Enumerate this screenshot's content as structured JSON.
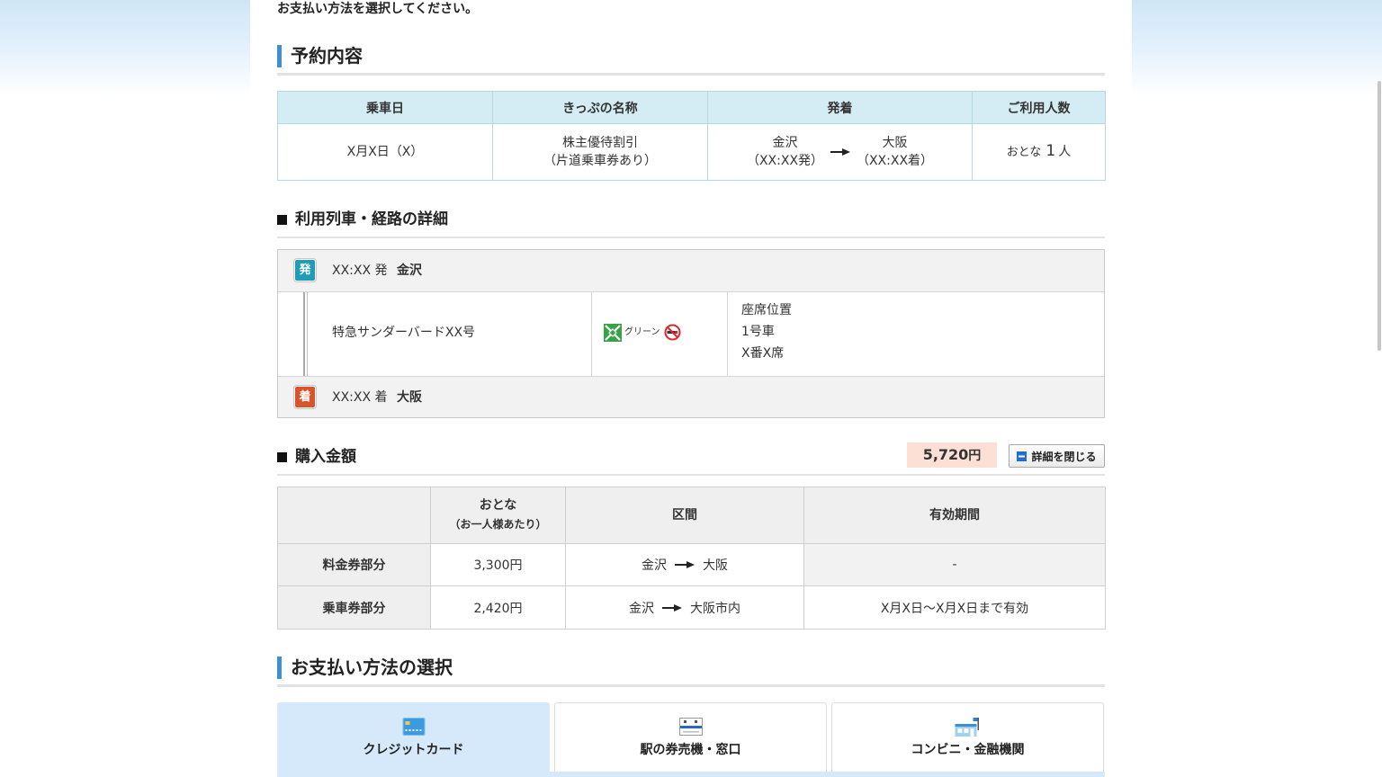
{
  "colors": {
    "heading_bar": "#3f8fd6",
    "reservation_header_bg": "#d4ecf3",
    "departure_badge": "#1f9db8",
    "arrival_badge": "#d9542a",
    "total_price_bg": "#fde0d5",
    "selected_tab_bg": "#d5e9fa",
    "green_car": "#35a447",
    "no_smoking": "#e0262d"
  },
  "instruction": "お支払い方法を選択してください。",
  "reservation": {
    "heading": "予約内容",
    "headers": {
      "date": "乗車日",
      "ticket_name": "きっぷの名称",
      "route": "発着",
      "passengers": "ご利用人数"
    },
    "date": "X月X日（X）",
    "ticket_name": [
      "株主優待割引",
      "（片道乗車券あり）"
    ],
    "departure": {
      "station": "金沢",
      "time": "（XX:XX発）"
    },
    "arrival": {
      "station": "大阪",
      "time": "（XX:XX着）"
    },
    "passengers": {
      "type": "おとな",
      "count": "1",
      "unit": "人"
    }
  },
  "route_detail": {
    "heading": "利用列車・経路の詳細",
    "departure": {
      "badge": "発",
      "time": "XX:XX 発",
      "station": "金沢"
    },
    "train": {
      "name": "特急サンダーバードXX号",
      "car_class": "グリーン",
      "car_class_icon": "green-car-icon",
      "smoking_icon": "no-smoking-icon",
      "seat_label": "座席位置",
      "car_number": "1号車",
      "seat_number": "X番X席"
    },
    "arrival": {
      "badge": "着",
      "time": "XX:XX 着",
      "station": "大阪"
    }
  },
  "purchase": {
    "heading": "購入金額",
    "total": {
      "amount": "5,720",
      "unit": "円"
    },
    "toggle": {
      "label": "詳細を閉じる",
      "icon": "minus-icon"
    },
    "headers": {
      "adult": "おとな",
      "adult_note": "（お一人様あたり）",
      "section": "区間",
      "validity": "有効期間"
    },
    "rows": [
      {
        "label": "料金券部分",
        "price": "3,300円",
        "from": "金沢",
        "to": "大阪",
        "validity": "-"
      },
      {
        "label": "乗車券部分",
        "price": "2,420円",
        "from": "金沢",
        "to": "大阪市内",
        "validity": "X月X日～X月X日まで有効"
      }
    ]
  },
  "payment": {
    "heading": "お支払い方法の選択",
    "methods": [
      {
        "label": "クレジットカード",
        "icon": "credit-card-icon",
        "selected": true
      },
      {
        "label": "駅の券売機・窓口",
        "icon": "ticket-icon",
        "selected": false
      },
      {
        "label": "コンビニ・金融機関",
        "icon": "convenience-store-icon",
        "selected": false
      }
    ]
  }
}
